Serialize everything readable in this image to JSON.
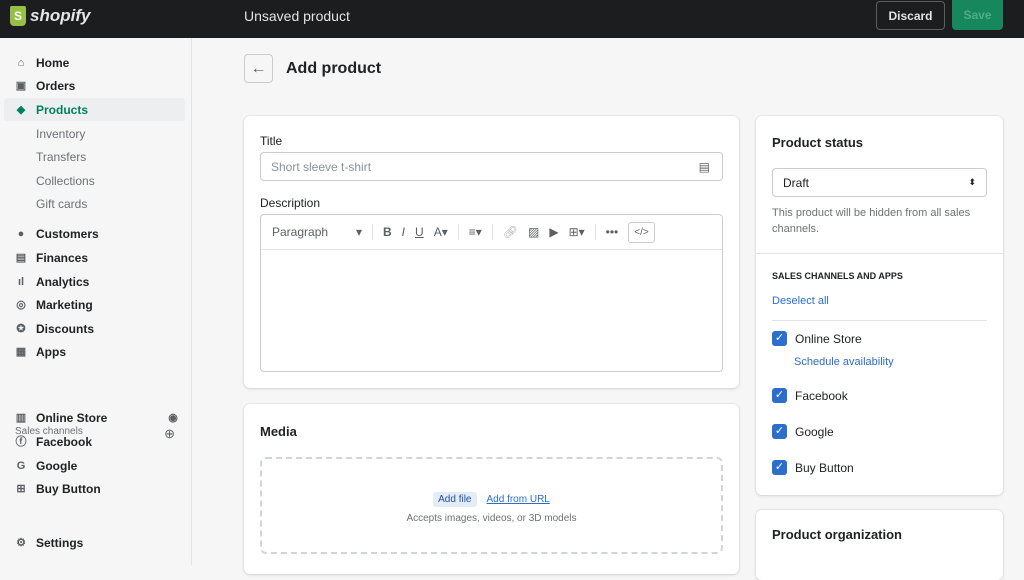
{
  "topbar": {
    "brand": "shopify",
    "title": "Unsaved product",
    "discard": "Discard",
    "save": "Save"
  },
  "sidebar": {
    "items": [
      {
        "label": "Home",
        "icon": "home-icon"
      },
      {
        "label": "Orders",
        "icon": "orders-icon"
      },
      {
        "label": "Products",
        "icon": "tag-icon"
      },
      {
        "label": "Inventory"
      },
      {
        "label": "Transfers"
      },
      {
        "label": "Collections"
      },
      {
        "label": "Gift cards"
      },
      {
        "label": "Customers",
        "icon": "person-icon"
      },
      {
        "label": "Finances",
        "icon": "finances-icon"
      },
      {
        "label": "Analytics",
        "icon": "analytics-icon"
      },
      {
        "label": "Marketing",
        "icon": "marketing-icon"
      },
      {
        "label": "Discounts",
        "icon": "discount-icon"
      },
      {
        "label": "Apps",
        "icon": "apps-icon"
      }
    ],
    "sales_channels_label": "Sales channels",
    "channels": [
      {
        "label": "Online Store"
      },
      {
        "label": "Facebook"
      },
      {
        "label": "Google"
      },
      {
        "label": "Buy Button"
      }
    ],
    "settings": "Settings"
  },
  "page": {
    "title": "Add product"
  },
  "form": {
    "title_label": "Title",
    "title_placeholder": "Short sleeve t-shirt",
    "description_label": "Description",
    "format": "Paragraph",
    "media_label": "Media",
    "add_file": "Add file",
    "add_url": "Add from URL",
    "media_hint": "Accepts images, videos, or 3D models"
  },
  "status": {
    "heading": "Product status",
    "value": "Draft",
    "hint": "This product will be hidden from all sales channels.",
    "channels_heading": "SALES CHANNELS AND APPS",
    "deselect": "Deselect all",
    "schedule": "Schedule availability",
    "channels": [
      "Online Store",
      "Facebook",
      "Google",
      "Buy Button"
    ]
  },
  "organization": {
    "heading": "Product organization"
  }
}
